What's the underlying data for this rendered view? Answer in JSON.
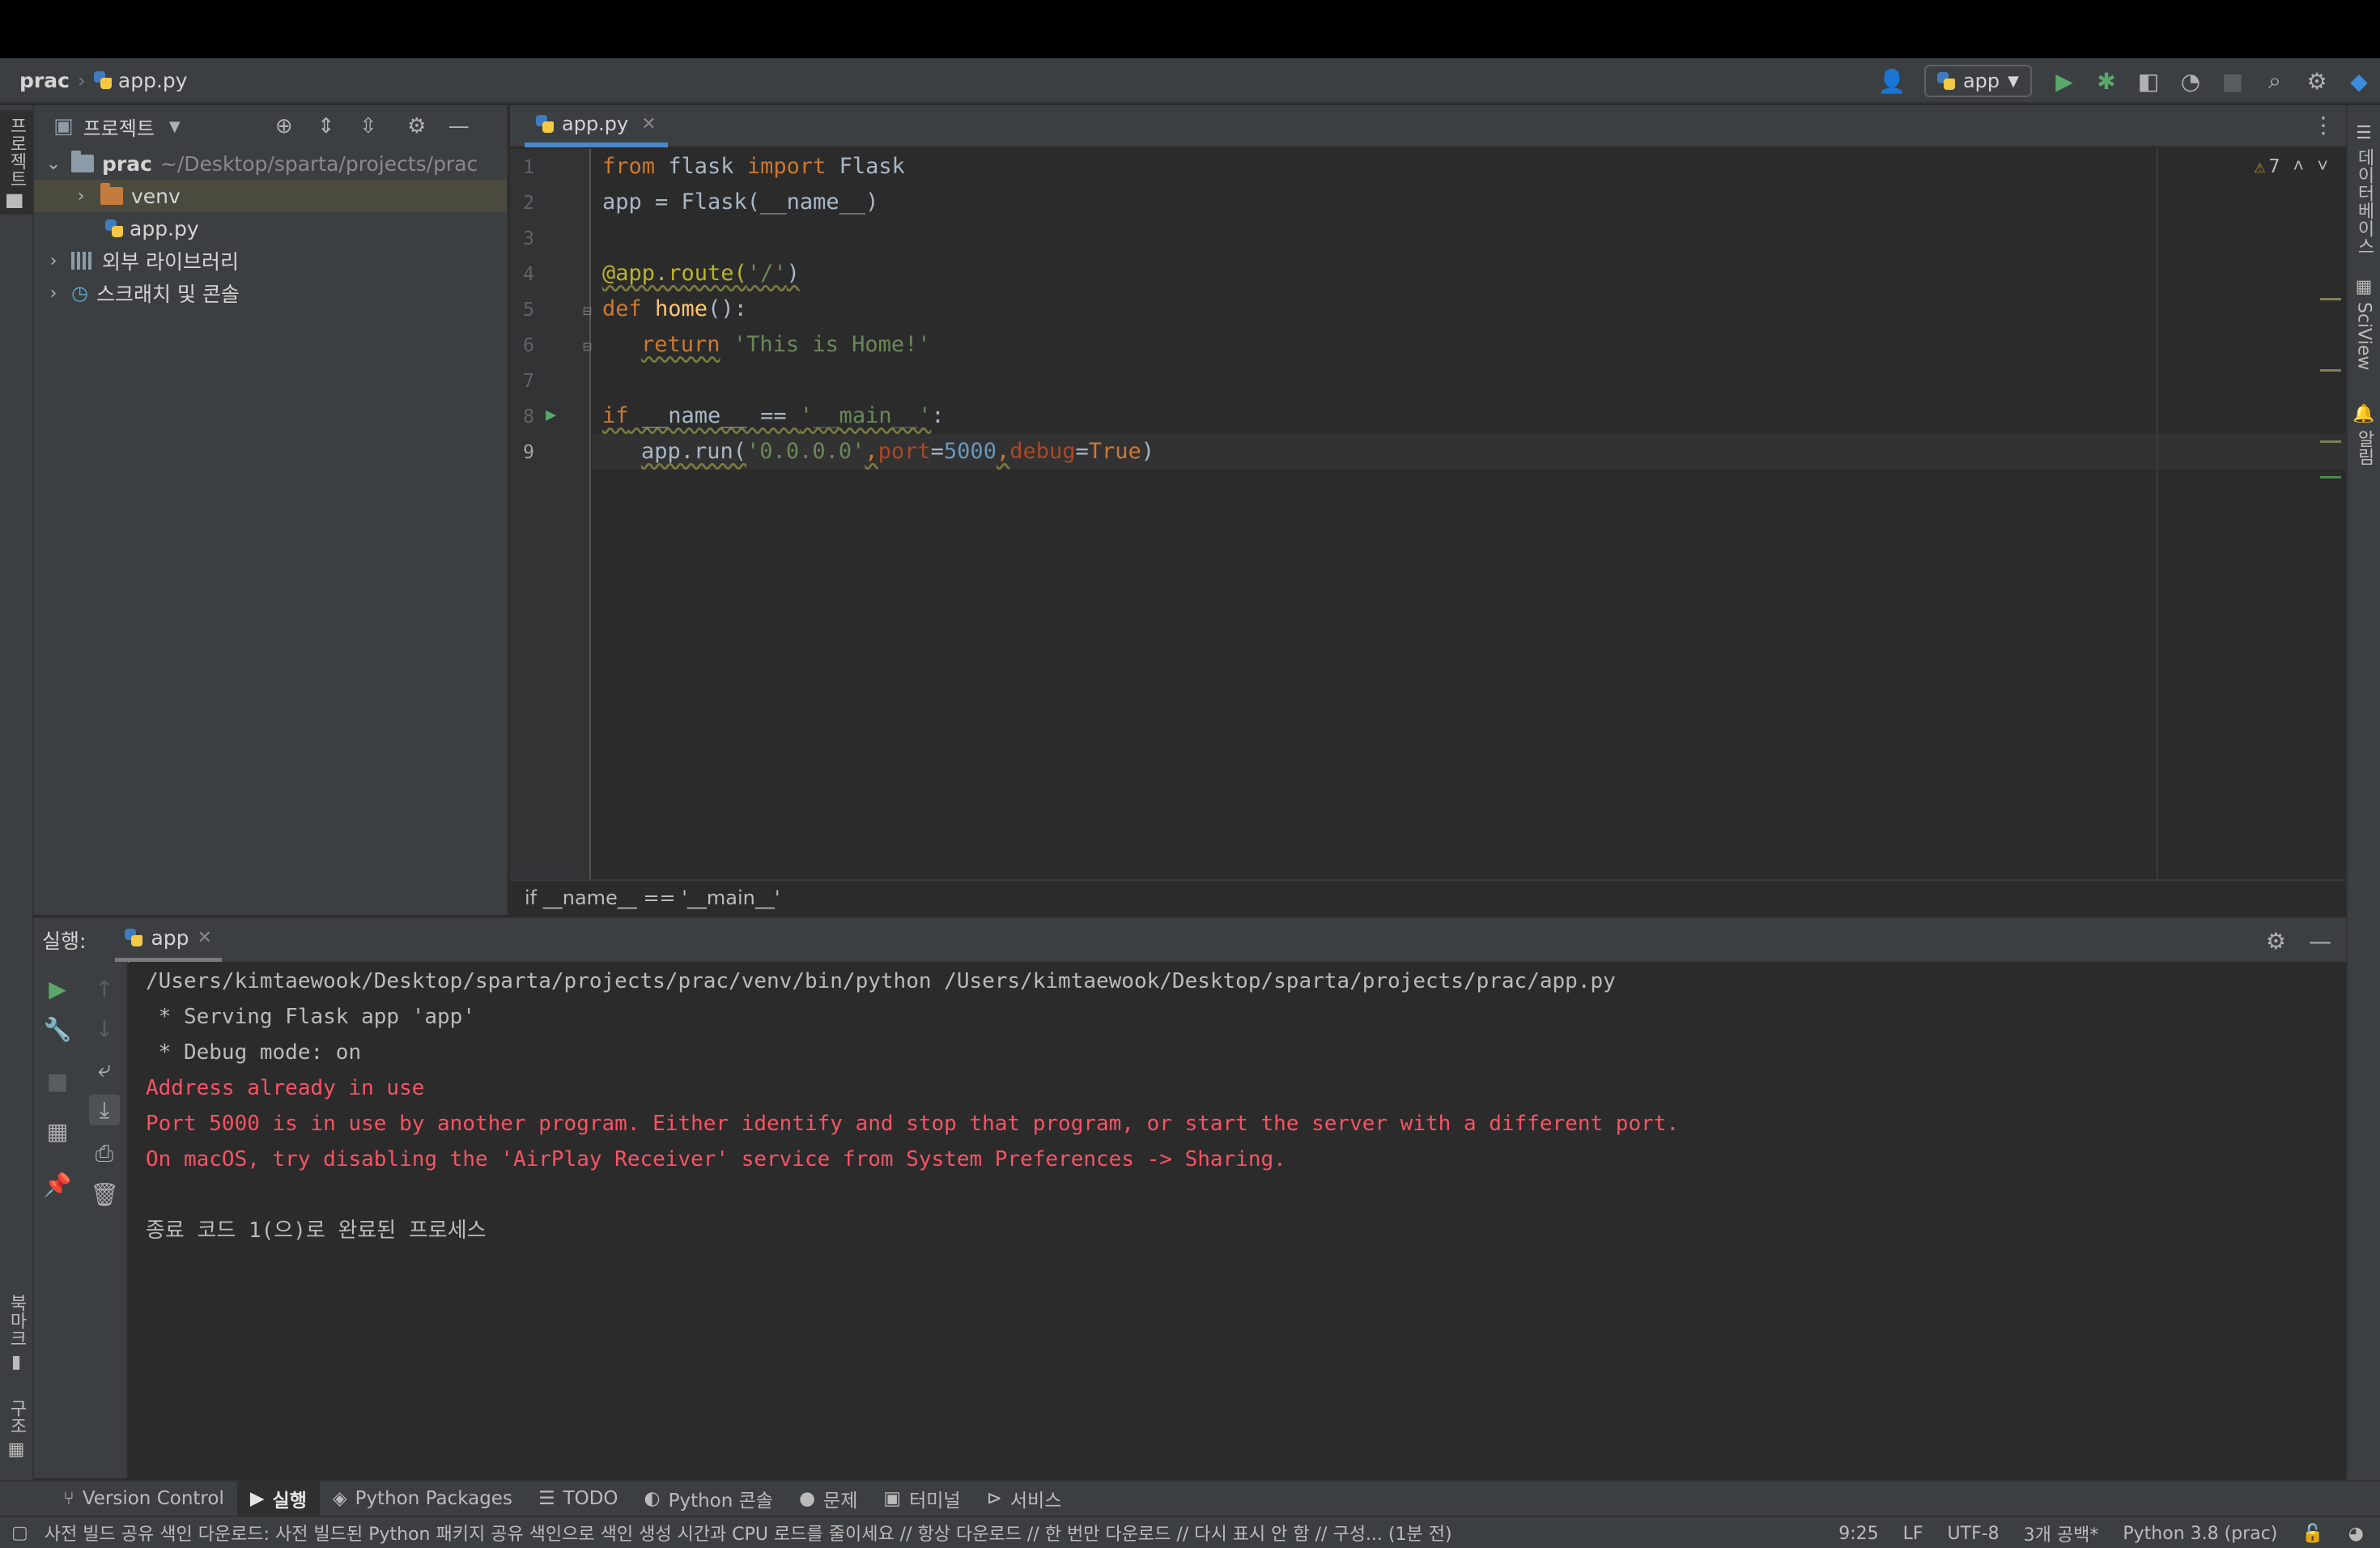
{
  "nav": {
    "project": "prac",
    "file": "app.py",
    "run_config": "app"
  },
  "left_strip": {
    "project_tab": "프로젝트",
    "bookmarks_tab": "북마크",
    "structure_tab": "구조"
  },
  "right_strip": {
    "database_tab": "데이터베이스",
    "sciview_tab": "SciView",
    "notifications_tab": "알림"
  },
  "project_panel": {
    "title": "프로젝트",
    "tree": [
      {
        "name": "prac",
        "path": "~/Desktop/sparta/projects/prac"
      },
      {
        "name": "venv"
      },
      {
        "name": "app.py"
      },
      {
        "name": "외부 라이브러리"
      },
      {
        "name": "스크래치 및 콘솔"
      }
    ]
  },
  "editor": {
    "tab": "app.py",
    "warnings": "7",
    "line_numbers": [
      "1",
      "2",
      "3",
      "4",
      "5",
      "6",
      "7",
      "8",
      "9"
    ],
    "lines": {
      "l1_kw1": "from",
      "l1_mod": " flask ",
      "l1_kw2": "import",
      "l1_name": " Flask",
      "l2": "app = Flask(__name__)",
      "l4_dec": "@app.route(",
      "l4_str": "'/'",
      "l4_end": ")",
      "l5_kw": "def",
      "l5_fn": " home",
      "l5_end": "():",
      "l6_kw": "return",
      "l6_str": " 'This is Home!'",
      "l8_kw": "if",
      "l8_mid": " __name__ == ",
      "l8_str": "'__main__'",
      "l8_end": ":",
      "l9_a": "app.run(",
      "l9_str": "'0.0.0.0'",
      "l9_c1": ",",
      "l9_p1": "port",
      "l9_eq1": "=",
      "l9_num": "5000",
      "l9_c2": ",",
      "l9_p2": "debug",
      "l9_eq2": "=",
      "l9_val": "True",
      "l9_end": ")"
    },
    "breadcrumb": "if __name__ == '__main__'"
  },
  "run": {
    "label": "실행:",
    "tab": "app",
    "output": [
      "/Users/kimtaewook/Desktop/sparta/projects/prac/venv/bin/python /Users/kimtaewook/Desktop/sparta/projects/prac/app.py",
      " * Serving Flask app 'app'",
      " * Debug mode: on",
      "Address already in use",
      "Port 5000 is in use by another program. Either identify and stop that program, or start the server with a different port.",
      "On macOS, try disabling the 'AirPlay Receiver' service from System Preferences -> Sharing.",
      "",
      "종료 코드 1(으)로 완료된 프로세스"
    ]
  },
  "tool_tabs": [
    "Version Control",
    "실행",
    "Python Packages",
    "TODO",
    "Python 콘솔",
    "문제",
    "터미널",
    "서비스"
  ],
  "status": {
    "message": "사전 빌드 공유 색인 다운로드: 사전 빌드된 Python 패키지 공유 색인으로 색인 생성 시간과 CPU 로드를 줄이세요 // 항상 다운로드 // 한 번만 다운로드 // 다시 표시 안 함 // 구성... (1분 전)",
    "position": "9:25",
    "line_sep": "LF",
    "encoding": "UTF-8",
    "indent": "3개 공백*",
    "interpreter": "Python 3.8 (prac)"
  }
}
